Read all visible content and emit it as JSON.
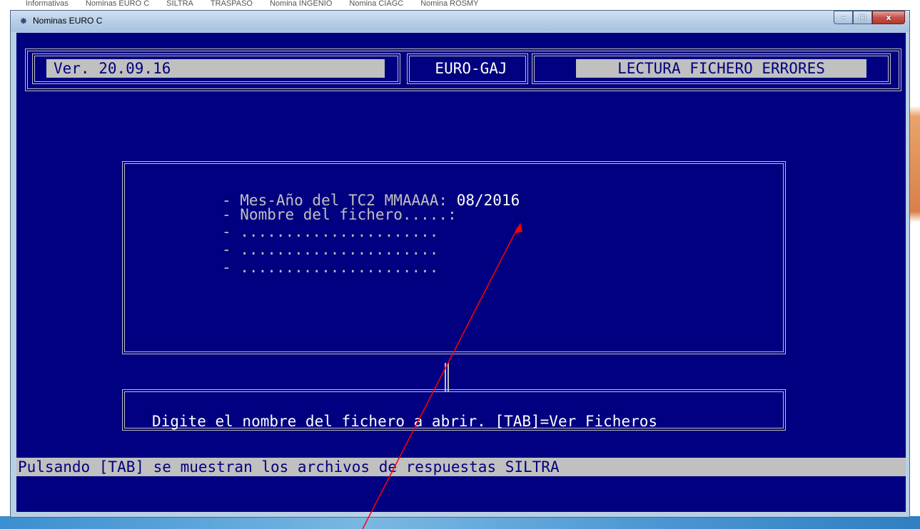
{
  "background_tabs": [
    "Informativas",
    "Nominas EURO C",
    "SILTRA",
    "TRASPASO",
    "Nomina INGENIO",
    "Nomina CIAGC",
    "Nomina ROSMY"
  ],
  "window": {
    "title": "Nominas EURO C",
    "minimize": "–",
    "maximize": "□",
    "close": "x"
  },
  "header": {
    "version": "Ver. 20.09.16",
    "company_code": "EURO-GAJ",
    "process_title": "LECTURA FICHERO ERRORES"
  },
  "form": {
    "month_year_label": "- Mes-Año del TC2 MMAAAA: ",
    "month_year_value": "08/2016",
    "filename_label": "- Nombre del fichero.....:",
    "line3": "- ......................",
    "line4": "- ......................",
    "line5": "- ......................"
  },
  "message": "Digite el nombre del fichero a abrir. [TAB]=Ver Ficheros",
  "status_bar": "Pulsando [TAB] se muestran los archivos de respuestas SILTRA",
  "colors": {
    "console_bg": "#000080",
    "text_gray": "#c0c0c0",
    "annotation_arrow": "#ff0000"
  }
}
